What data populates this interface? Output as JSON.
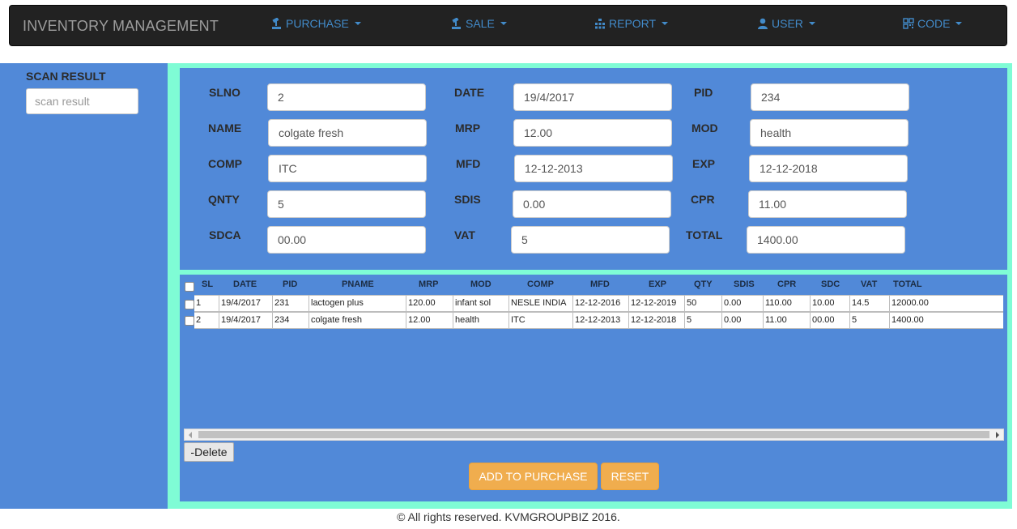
{
  "navbar": {
    "brand": "INVENTORY MANAGEMENT",
    "items": [
      {
        "label": "PURCHASE",
        "icon": "gavel-icon"
      },
      {
        "label": "SALE",
        "icon": "gavel-icon"
      },
      {
        "label": "REPORT",
        "icon": "sitemap-icon"
      },
      {
        "label": "USER",
        "icon": "user-icon"
      },
      {
        "label": "CODE",
        "icon": "qrcode-icon"
      }
    ]
  },
  "scan": {
    "title": "SCAN RESULT",
    "placeholder": "scan result"
  },
  "form": {
    "slno_label": "SLNO",
    "slno": "2",
    "date_label": "DATE",
    "date": "19/4/2017",
    "pid_label": "PID",
    "pid": "234",
    "name_label": "NAME",
    "name": "colgate fresh",
    "mrp_label": "MRP",
    "mrp": "12.00",
    "mod_label": "MOD",
    "mod": "health",
    "comp_label": "COMP",
    "comp": "ITC",
    "mfd_label": "MFD",
    "mfd": "12-12-2013",
    "exp_label": "EXP",
    "exp": "12-12-2018",
    "qnty_label": "QNTY",
    "qnty": "5",
    "sdis_label": "SDIS",
    "sdis": "0.00",
    "cpr_label": "CPR",
    "cpr": "11.00",
    "sdca_label": "SDCA",
    "sdca": "00.00",
    "vat_label": "VAT",
    "vat": "5",
    "total_label": "TOTAL",
    "total": "1400.00"
  },
  "table": {
    "headers": [
      "SL",
      "DATE",
      "PID",
      "PNAME",
      "MRP",
      "MOD",
      "COMP",
      "MFD",
      "EXP",
      "QTY",
      "SDIS",
      "CPR",
      "SDC",
      "VAT",
      "TOTAL"
    ],
    "rows": [
      [
        "1",
        "19/4/2017",
        "231",
        "lactogen plus",
        "120.00",
        "infant sol",
        "NESLE INDIA",
        "12-12-2016",
        "12-12-2019",
        "50",
        "0.00",
        "110.00",
        "10.00",
        "14.5",
        "12000.00"
      ],
      [
        "2",
        "19/4/2017",
        "234",
        "colgate fresh",
        "12.00",
        "health",
        "ITC",
        "12-12-2013",
        "12-12-2018",
        "5",
        "0.00",
        "11.00",
        "00.00",
        "5",
        "1400.00"
      ]
    ]
  },
  "actions": {
    "delete": "-Delete",
    "add": "ADD TO PURCHASE",
    "reset": "RESET"
  },
  "footer": "© All rights reserved. KVMGROUPBIZ 2016.",
  "colors": {
    "panel_blue": "#5189d8",
    "frame_aqua": "#7ffcd5",
    "navbar": "#222222",
    "nav_link": "#428bca",
    "warning": "#f0ad4e"
  }
}
